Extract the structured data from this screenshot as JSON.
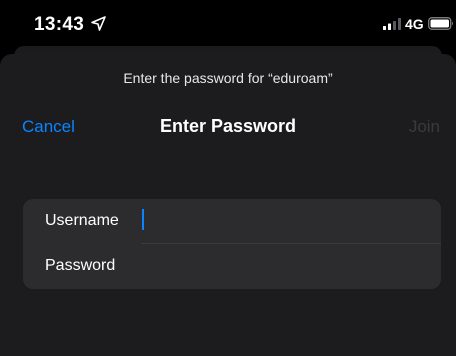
{
  "status_bar": {
    "time": "13:43",
    "network": "4G",
    "icons": [
      "location-arrow-icon",
      "cellular-signal-icon",
      "battery-icon"
    ]
  },
  "sheet": {
    "prompt": "Enter the password for “eduroam”",
    "title": "Enter Password",
    "cancel_label": "Cancel",
    "join_label": "Join"
  },
  "form": {
    "username_label": "Username",
    "username_value": "",
    "password_label": "Password",
    "password_value": ""
  },
  "colors": {
    "accent": "#0a84ff",
    "sheet_bg": "#1c1c1e",
    "field_bg": "#2c2c2e",
    "disabled_text": "#3a3a3c"
  }
}
